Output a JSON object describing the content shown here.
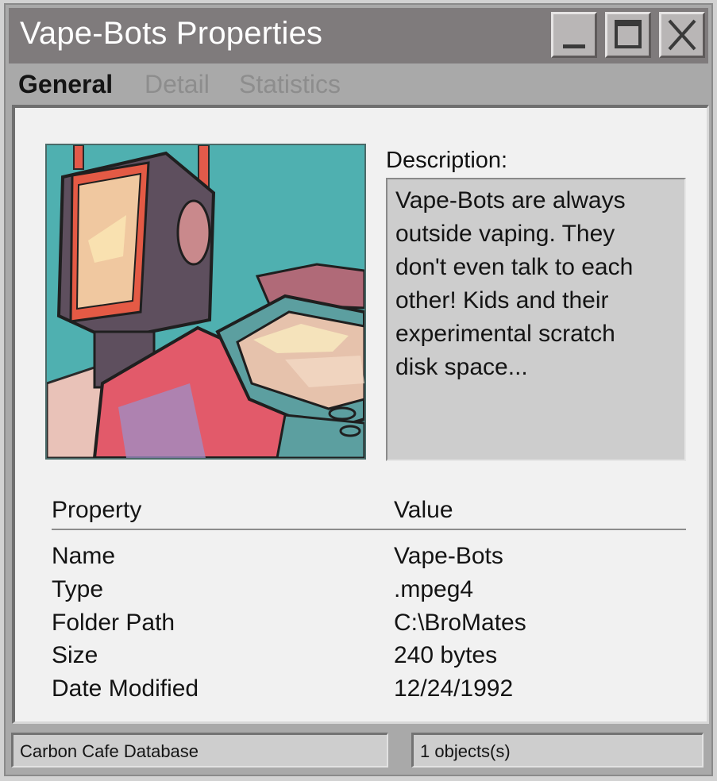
{
  "window": {
    "title": "Vape-Bots Properties",
    "controls": {
      "minimize": "minimize-icon",
      "maximize": "maximize-icon",
      "close": "close-icon"
    }
  },
  "tabs": [
    {
      "label": "General",
      "active": true
    },
    {
      "label": "Detail",
      "active": false
    },
    {
      "label": "Statistics",
      "active": false
    }
  ],
  "preview": {
    "subject": "robot-illustration"
  },
  "description": {
    "label": "Description:",
    "lines": [
      "Vape-Bots are always",
      "outside vaping. They",
      "don't even talk to each",
      "other! Kids and their",
      "experimental scratch",
      "disk space..."
    ]
  },
  "properties": {
    "header_property": "Property",
    "header_value": "Value",
    "rows": [
      {
        "key": "Name",
        "value": "Vape-Bots"
      },
      {
        "key": "Type",
        "value": ".mpeg4"
      },
      {
        "key": "Folder Path",
        "value": "C:\\BroMates"
      },
      {
        "key": "Size",
        "value": "240 bytes"
      },
      {
        "key": "Date Modified",
        "value": "12/24/1992"
      }
    ]
  },
  "statusbar": {
    "left": "Carbon Cafe Database",
    "right": "1 objects(s)"
  },
  "colors": {
    "titlebar": "#7f7b7c",
    "panel": "#f1f1f1",
    "teal": "#4fb0b0"
  }
}
